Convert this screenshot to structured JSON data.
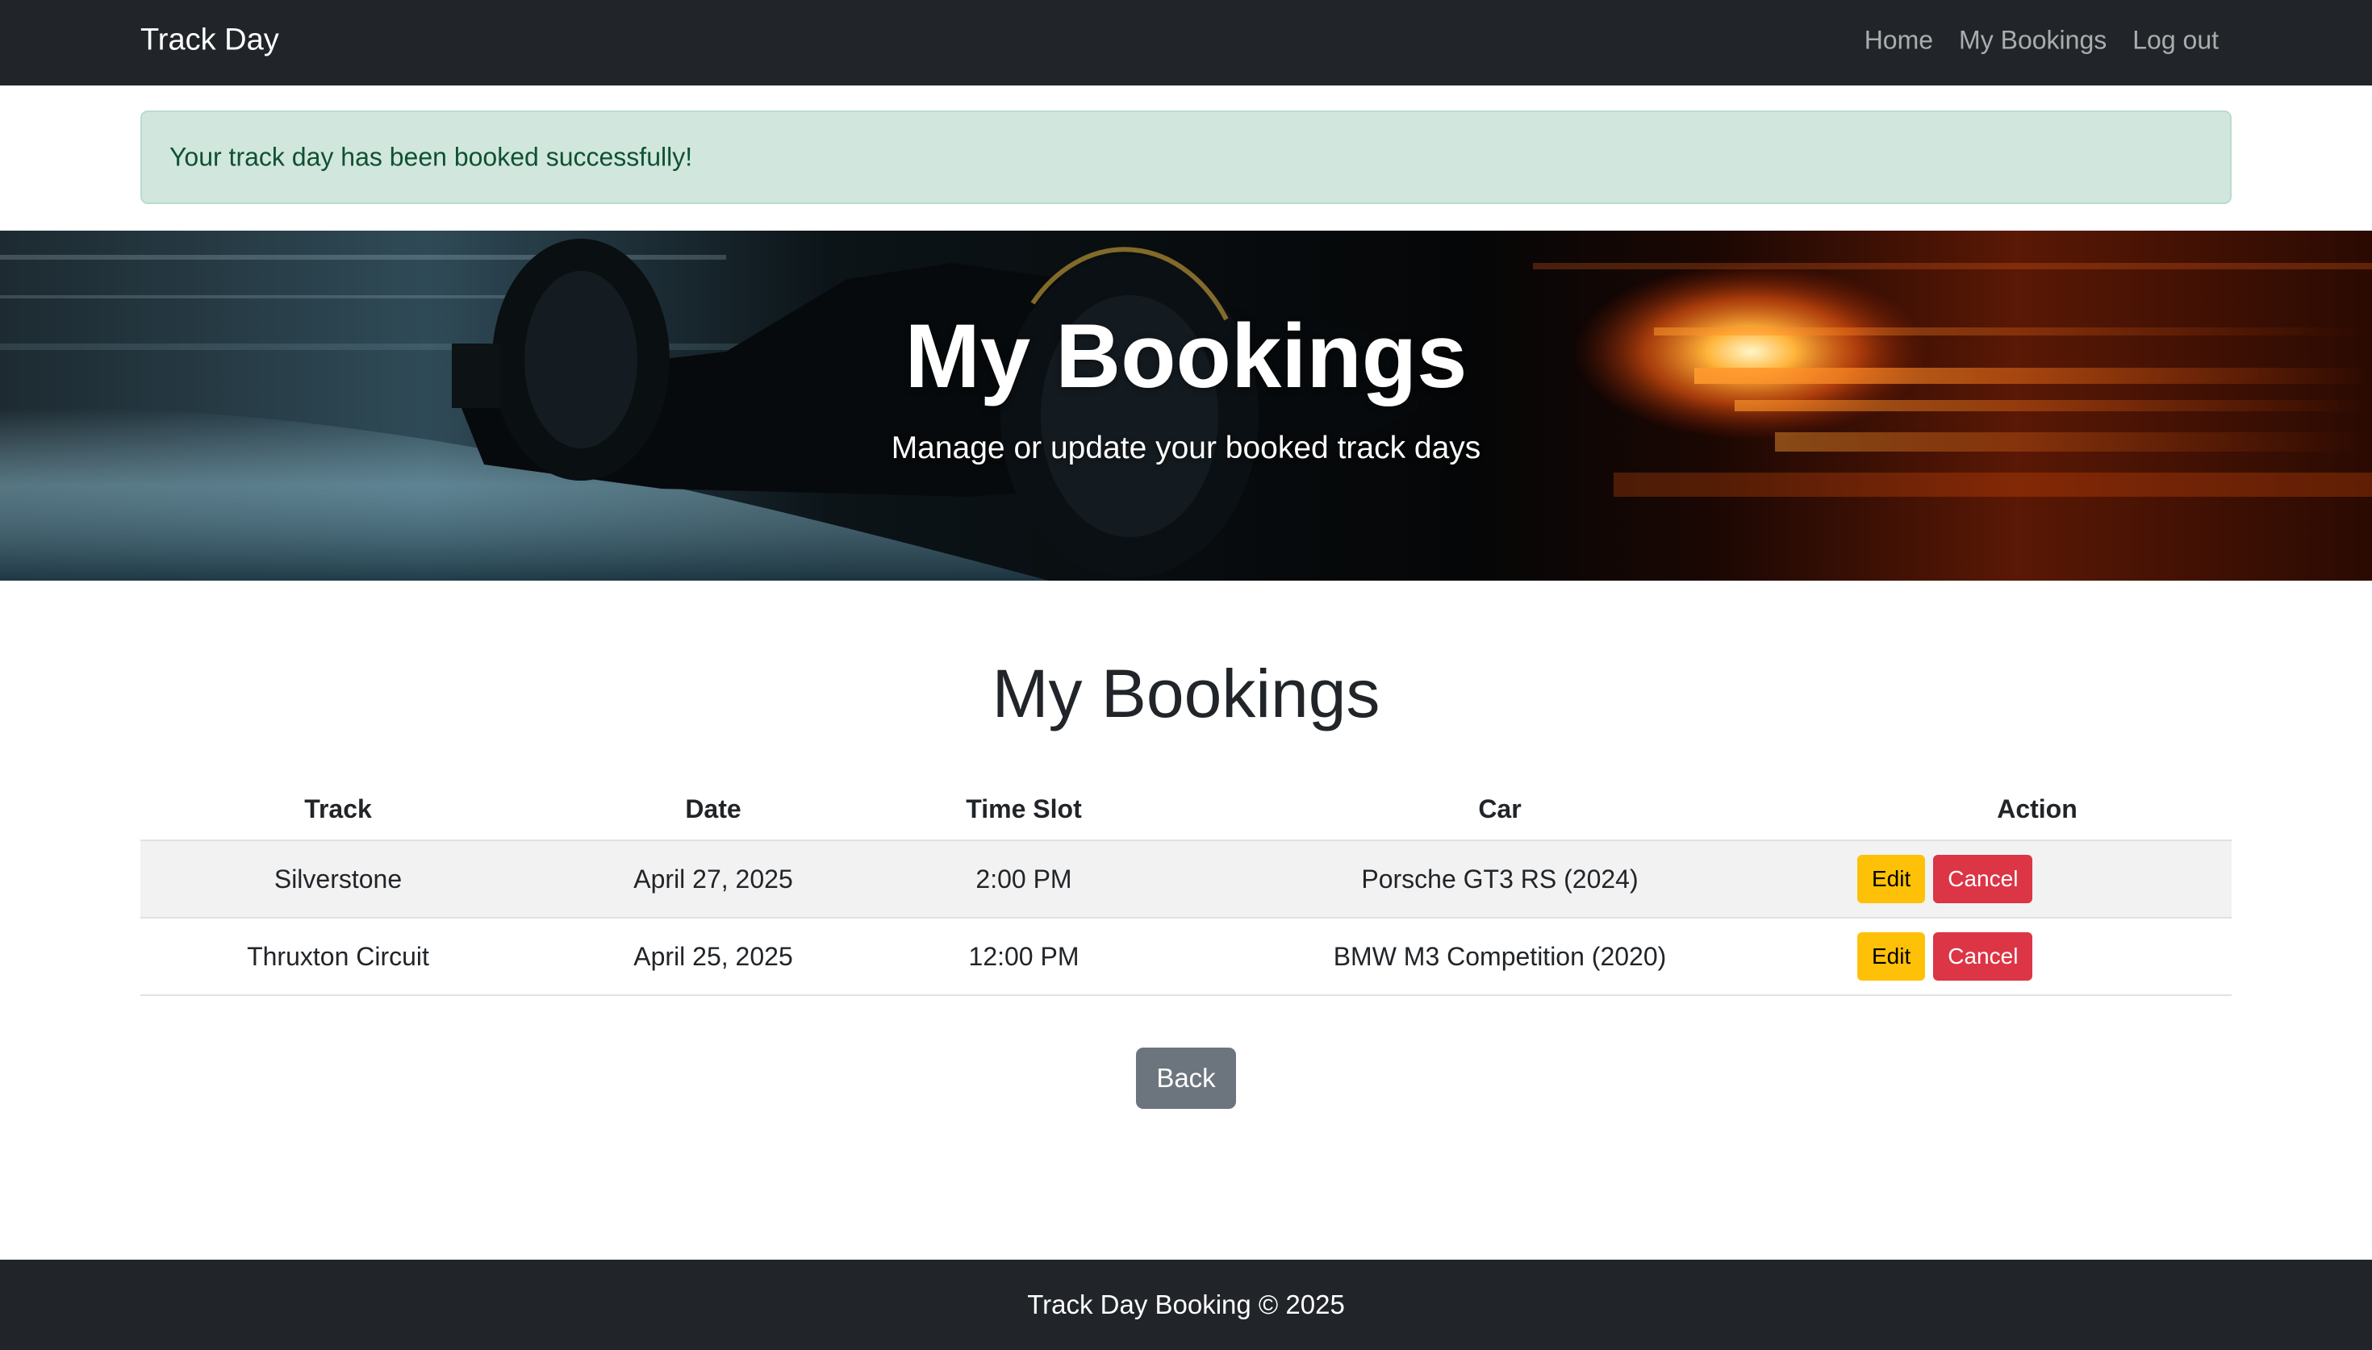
{
  "navbar": {
    "brand": "Track Day",
    "links": [
      {
        "label": "Home"
      },
      {
        "label": "My Bookings"
      },
      {
        "label": "Log out"
      }
    ]
  },
  "alert": {
    "message": "Your track day has been booked successfully!",
    "background": "#d1e7dd",
    "text_color": "#0f5132"
  },
  "hero": {
    "title": "My Bookings",
    "subtitle": "Manage or update your booked track days"
  },
  "main": {
    "title": "My Bookings",
    "table": {
      "headers": [
        "Track",
        "Date",
        "Time Slot",
        "Car",
        "Action"
      ],
      "rows": [
        {
          "track": "Silverstone",
          "date": "April 27, 2025",
          "time": "2:00 PM",
          "car": "Porsche GT3 RS (2024)",
          "edit_label": "Edit",
          "cancel_label": "Cancel"
        },
        {
          "track": "Thruxton Circuit",
          "date": "April 25, 2025",
          "time": "12:00 PM",
          "car": "BMW M3 Competition (2020)",
          "edit_label": "Edit",
          "cancel_label": "Cancel"
        }
      ]
    },
    "back_label": "Back"
  },
  "footer": {
    "text": "Track Day Booking © 2025"
  },
  "colors": {
    "navbar": "#212529",
    "warning": "#ffc107",
    "danger": "#dc3545",
    "secondary": "#6c757d"
  }
}
